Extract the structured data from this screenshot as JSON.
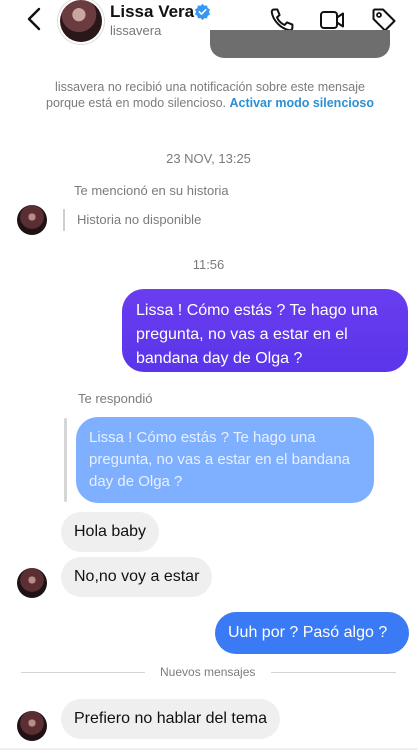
{
  "header": {
    "name": "Lissa Vera",
    "handle": "lissavera"
  },
  "notice": {
    "text": "lissavera no recibió una notificación sobre este mensaje porque está en modo silencioso.",
    "link": "Activar modo silencioso"
  },
  "messages": {
    "timestamp1": "23 NOV, 13:25",
    "story_mention": "Te mencionó en su historia",
    "story_unavailable": "Historia no disponible",
    "timestamp2": "11:56",
    "sent1": "Lissa ! Cómo estás ? Te hago una pregunta, no vas a estar en el bandana day de Olga ?",
    "replied_label": "Te respondió",
    "reply_quote": "Lissa ! Cómo estás ? Te hago una pregunta, no vas a estar en el bandana day de Olga ?",
    "recv1": "Hola baby",
    "recv2": "No,no voy a estar",
    "sent2": "Uuh por ? Pasó algo ?",
    "new_messages": "Nuevos mensajes",
    "recv3": "Prefiero no hablar del tema"
  },
  "colors": {
    "sent_gradient": "#5a35ea",
    "sent_blue": "#3a7af5",
    "reply_quote_bg": "#7fb0ff",
    "received_bg": "#efefef",
    "link": "#2b8fd6",
    "verified": "#3897f0"
  },
  "icons": [
    "chevron-left-icon",
    "verified-icon",
    "phone-icon",
    "video-icon",
    "tag-icon"
  ]
}
